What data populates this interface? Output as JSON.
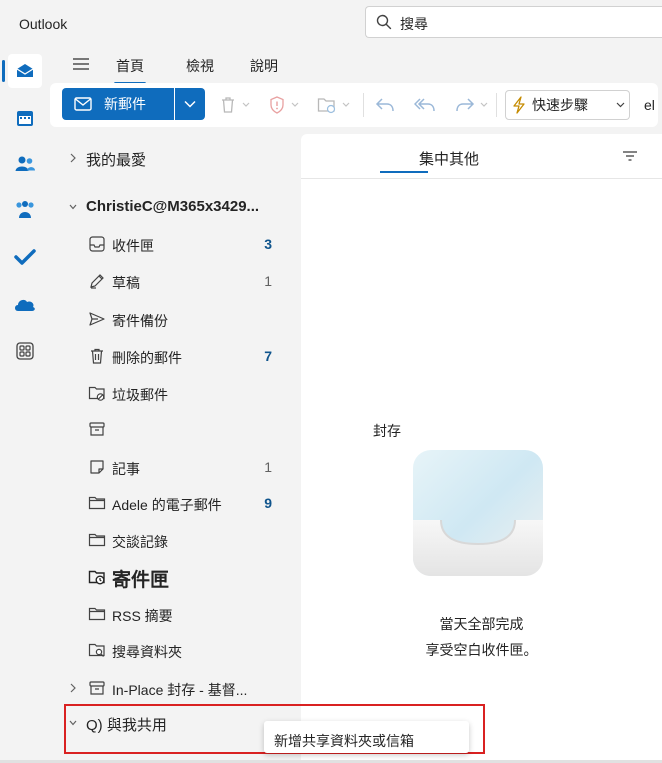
{
  "app": {
    "title": "Outlook"
  },
  "search": {
    "placeholder": "搜尋"
  },
  "tabs": [
    {
      "label": "首頁",
      "active": true
    },
    {
      "label": "檢視",
      "active": false
    },
    {
      "label": "說明",
      "active": false
    }
  ],
  "ribbon": {
    "new_mail": "新郵件",
    "quick_steps": "快速步驟",
    "truncated": "el"
  },
  "folders": {
    "favorites": "我的最愛",
    "account": "ChristieC@M365x3429...",
    "items": [
      {
        "label": "收件匣",
        "count": "3",
        "bold_count": true,
        "icon": "inbox-icon"
      },
      {
        "label": "草稿",
        "count": "1",
        "bold_count": false,
        "icon": "draft-icon"
      },
      {
        "label": "寄件備份",
        "count": "",
        "bold_count": false,
        "icon": "send-icon"
      },
      {
        "label": "刪除的郵件",
        "count": "7",
        "bold_count": true,
        "icon": "trash-icon"
      },
      {
        "label": "垃圾郵件",
        "count": "",
        "bold_count": false,
        "icon": "junk-folder-icon"
      },
      {
        "label": "",
        "count": "",
        "bold_count": false,
        "icon": "archive-icon"
      },
      {
        "label": "記事",
        "count": "1",
        "bold_count": false,
        "icon": "note-icon"
      },
      {
        "label": "Adele 的電子郵件",
        "count": "9",
        "bold_count": true,
        "icon": "folder-icon"
      },
      {
        "label": "交談記錄",
        "count": "",
        "bold_count": false,
        "icon": "folder-icon"
      },
      {
        "label": "寄件匣",
        "count": "",
        "bold_count": false,
        "icon": "outbox-icon",
        "large": true
      },
      {
        "label": "RSS 摘要",
        "count": "",
        "bold_count": false,
        "icon": "folder-icon"
      },
      {
        "label": "搜尋資料夾",
        "count": "",
        "bold_count": false,
        "icon": "search-folder-icon"
      }
    ],
    "in_place_archive": "In-Place 封存 - 基督...",
    "shared_with_me": "Q) 與我共用"
  },
  "message_list": {
    "focus_tab": "集中其他",
    "archive_label": "封存",
    "empty_line1": "當天全部完成",
    "empty_line2": "享受空白收件匣。"
  },
  "popup": {
    "label": "新增共享資料夾或信箱"
  },
  "colors": {
    "accent": "#0f6cbd",
    "highlight": "#d92121"
  }
}
